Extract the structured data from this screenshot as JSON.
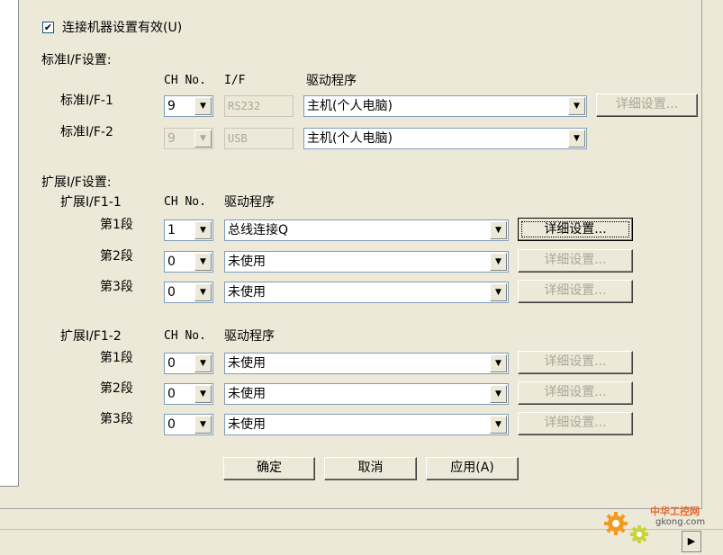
{
  "enable_checkbox": {
    "checked": true,
    "label": "连接机器设置有效(U)",
    "check_mark": "✔"
  },
  "standard": {
    "section_title": "标准I/F设置:",
    "col_ch": "CH No.",
    "col_if": "I/F",
    "col_driver": "驱动程序",
    "rows": [
      {
        "label": "标准I/F-1",
        "ch": "9",
        "if": "RS232",
        "driver": "主机(个人电脑)",
        "detail": "详细设置..."
      },
      {
        "label": "标准I/F-2",
        "ch": "9",
        "if": "USB",
        "driver": "主机(个人电脑)"
      }
    ]
  },
  "extended": {
    "section_title": "扩展I/F设置:",
    "groups": [
      {
        "title": "扩展I/F1-1",
        "col_ch": "CH No.",
        "col_driver": "驱动程序",
        "rows": [
          {
            "label": "第1段",
            "ch": "1",
            "driver": "总线连接Q",
            "detail": "详细设置..."
          },
          {
            "label": "第2段",
            "ch": "0",
            "driver": "未使用",
            "detail": "详细设置..."
          },
          {
            "label": "第3段",
            "ch": "0",
            "driver": "未使用",
            "detail": "详细设置..."
          }
        ]
      },
      {
        "title": "扩展I/F1-2",
        "col_ch": "CH No.",
        "col_driver": "驱动程序",
        "rows": [
          {
            "label": "第1段",
            "ch": "0",
            "driver": "未使用",
            "detail": "详细设置..."
          },
          {
            "label": "第2段",
            "ch": "0",
            "driver": "未使用",
            "detail": "详细设置..."
          },
          {
            "label": "第3段",
            "ch": "0",
            "driver": "未使用",
            "detail": "详细设置..."
          }
        ]
      }
    ]
  },
  "buttons": {
    "ok": "确定",
    "cancel": "取消",
    "apply": "应用(A)"
  },
  "icons": {
    "dropdown": "▼",
    "scroll_right": "▶"
  },
  "watermark": {
    "brand": "中华工控网",
    "domain": "gkong.com"
  }
}
